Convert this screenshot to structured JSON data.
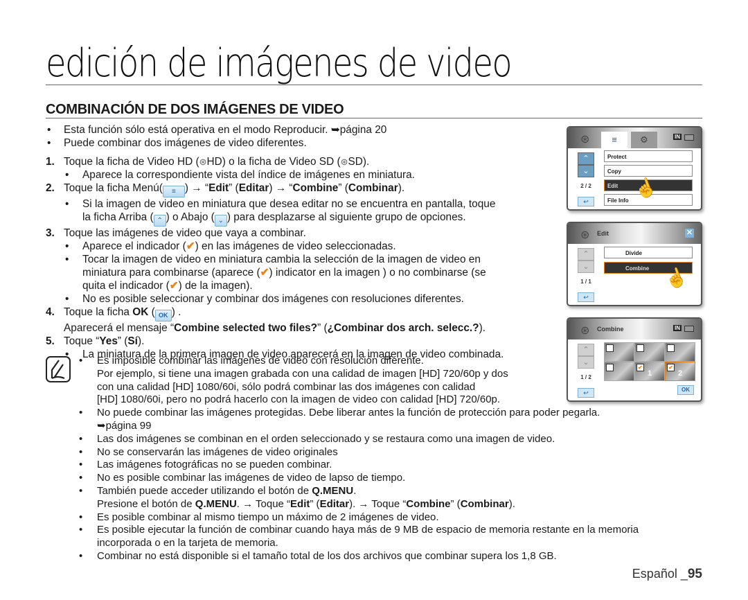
{
  "page_title": "edición de imágenes de video",
  "section_title": "COMBINACIÓN DE DOS IMÁGENES DE VIDEO",
  "intro": [
    "Esta función sólo está operativa en el modo Reproducir. ➥página 20",
    "Puede combinar dos imágenes de video diferentes."
  ],
  "steps": {
    "s1": {
      "num": "1.",
      "pre": "Toque la ficha de Video HD (",
      "mid": "HD) o la ficha de Video SD (",
      "post": "SD)."
    },
    "s1b": "Aparece la correspondiente vista del índice de imágenes en miniatura.",
    "s2": {
      "num": "2.",
      "pre": "Toque la ficha Menú(",
      "a": ") → “",
      "edit": "Edit",
      "b": "” (",
      "editar": "Editar",
      "c": ") → “",
      "combine": "Combine",
      "d": "” (",
      "combinar": "Combinar",
      "e": ")."
    },
    "s2b_line1": "Si la imagen de video en miniatura que desea editar no se encuentra en pantalla, toque",
    "s2b_line2": {
      "a": "la ficha Arriba (",
      "b": ") o Abajo (",
      "c": ") para desplazarse al siguiente grupo de opciones."
    },
    "s3": {
      "num": "3.",
      "text": "Toque las imágenes de video que vaya a combinar."
    },
    "s3b": {
      "a": "Aparece el indicador (",
      "b": ") en las imágenes de video seleccionadas."
    },
    "s3c_line1": "Tocar la imagen de video en miniatura cambia la selección de la imagen de video en",
    "s3c_line2": {
      "a": "miniatura para combinarse (aparece (",
      "b": ") indicator en la imagen ) o no combinarse (se"
    },
    "s3c_line3": {
      "a": "quita el indicador (",
      "b": ") de la imagen)."
    },
    "s3d": "No es posible seleccionar y combinar dos imágenes con resoluciones diferentes.",
    "s4": {
      "num": "4.",
      "a": "Toque la ficha ",
      "ok": "OK",
      "b": " (",
      "c": ") ."
    },
    "s4b": {
      "a": "Aparecerá el mensaje “",
      "msg": "Combine selected two files?",
      "b": "” (",
      "msg_es": "¿Combinar dos arch. selecc.?",
      "c": ")."
    },
    "s5": {
      "num": "5.",
      "a": "Toque “",
      "yes": "Yes",
      "b": "” (",
      "si": "Sí",
      "c": ")."
    },
    "s5b": "La miniatura de la primera imagen de video aparecerá en la imagen de video combinada."
  },
  "icons": {
    "menu": "≡",
    "up": "⌃",
    "down": "⌄",
    "check": "✔",
    "ok": "OK",
    "film": "⊛"
  },
  "notes": {
    "n1": [
      "Es imposible combinar las imágenes de video con resolución diferente.",
      "Por ejemplo, si tiene una imagen grabada con una calidad de imagen [HD] 720/60p y dos",
      "con una calidad [HD] 1080/60i, sólo podrá combinar las dos imágenes con calidad",
      "[HD] 1080/60i, pero no podrá hacerlo con la imagen de video con calidad [HD] 720/60p."
    ],
    "n2": [
      "No puede combinar las imágenes protegidas. Debe liberar antes la función de protección para poder pegarla.",
      "➥página 99"
    ],
    "n3": "Las dos imágenes se combinan en el orden seleccionado y se restaura como una imagen de video.",
    "n4": "No se conservarán las imágenes de video originales",
    "n5": "Las imágenes fotográficas no se pueden combinar.",
    "n6": "No es posible combinar las imágenes de video de lapso de tiempo.",
    "n7": {
      "a": "También puede acceder utilizando el botón de ",
      "qmenu": "Q.MENU",
      "b": "."
    },
    "n7b": {
      "a": "Presione el botón de ",
      "qmenu": "Q.MENU",
      "b": ". → Toque “",
      "edit": "Edit",
      "c": "” (",
      "editar": "Editar",
      "d": "). → Toque “",
      "combine": "Combine",
      "e": "” (",
      "combinar": "Combinar",
      "f": ")."
    },
    "n8": "Es posible combinar al mismo tiempo un máximo de 2 imágenes de video.",
    "n9": [
      "Es posible ejecutar la función de combinar cuando haya más de 9 MB de espacio de memoria restante en la memoria",
      "incorporada o en la tarjeta de memoria."
    ],
    "n10": "Combinar no está disponible si el tamaño total de los dos archivos que combinar supera los 1,8 GB."
  },
  "footer": {
    "lang": "Español _",
    "page": "95"
  },
  "screens": {
    "menu": {
      "page": "2 / 2",
      "badge": "IN",
      "items": [
        "Protect",
        "Copy",
        "Edit",
        "File Info"
      ],
      "selected": "Edit"
    },
    "edit": {
      "title": "Edit",
      "page": "1 / 1",
      "items": [
        "Divide",
        "Combine"
      ],
      "selected": "Combine"
    },
    "combine": {
      "title": "Combine",
      "page": "1 / 2",
      "badge": "IN",
      "ok": "OK",
      "thumbs": [
        {
          "checked": false,
          "label": ""
        },
        {
          "checked": false,
          "label": ""
        },
        {
          "checked": false,
          "label": ""
        },
        {
          "checked": false,
          "label": ""
        },
        {
          "checked": true,
          "label": "1"
        },
        {
          "checked": true,
          "label": "2"
        }
      ]
    }
  }
}
